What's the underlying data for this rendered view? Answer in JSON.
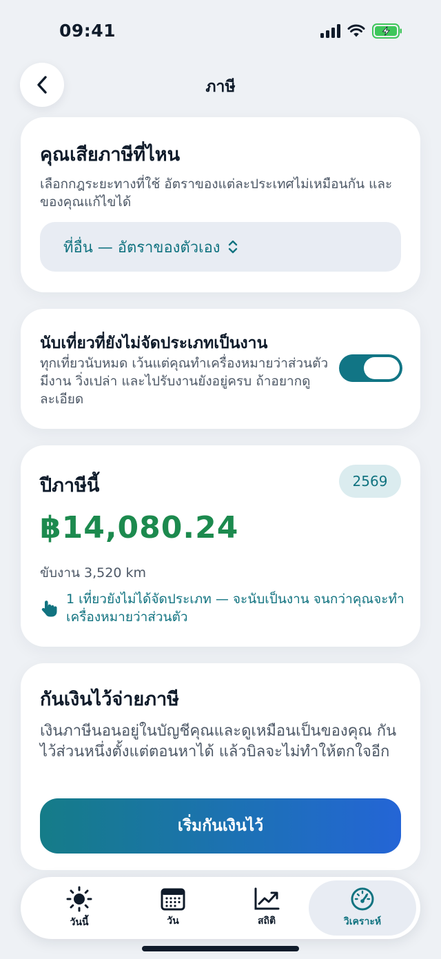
{
  "status_bar": {
    "time": "09:41"
  },
  "header": {
    "title": "ภาษี"
  },
  "where_card": {
    "title": "คุณเสียภาษีที่ไหน",
    "description": "เลือกกฎระยะทางที่ใช้ อัตราของแต่ละประเทศไม่เหมือนกัน และของคุณแก้ไขได้",
    "selected_region": "ที่อื่น — อัตราของตัวเอง"
  },
  "count_card": {
    "title": "นับเที่ยวที่ยังไม่จัดประเภทเป็นงาน",
    "description": "ทุกเที่ยวนับหมด เว้นแต่คุณทำเครื่องหมายว่าส่วนตัว มีงาน วิ่งเปล่า และไปรับงานยังอยู่ครบ ถ้าอยากดูละเอียด",
    "toggle_on": true
  },
  "year_card": {
    "title": "ปีภาษีนี้",
    "year_badge": "2569",
    "amount": "฿14,080.24",
    "distance": "ขับงาน 3,520 km",
    "note": "1 เที่ยวยังไม่ได้จัดประเภท — จะนับเป็นงาน จนกว่าคุณจะทำเครื่องหมายว่าส่วนตัว"
  },
  "save_card": {
    "title": "กันเงินไว้จ่ายภาษี",
    "description": "เงินภาษีนอนอยู่ในบัญชีคุณและดูเหมือนเป็นของคุณ กันไว้ส่วนหนึ่งตั้งแต่ตอนหาได้ แล้วบิลจะไม่ทำให้ตกใจอีก",
    "button_label": "เริ่มกันเงินไว้"
  },
  "tab_bar": {
    "tabs": [
      {
        "label": "วันนี้",
        "icon": "sun-icon"
      },
      {
        "label": "วัน",
        "icon": "calendar-icon"
      },
      {
        "label": "สถิติ",
        "icon": "chart-icon"
      },
      {
        "label": "วิเคราะห์",
        "icon": "gauge-icon"
      }
    ],
    "active": "วิเคราะห์"
  },
  "colors": {
    "accent": "#117380",
    "amount": "#1c8a4e",
    "toggle": "#117585",
    "background": "#eef1f5"
  }
}
